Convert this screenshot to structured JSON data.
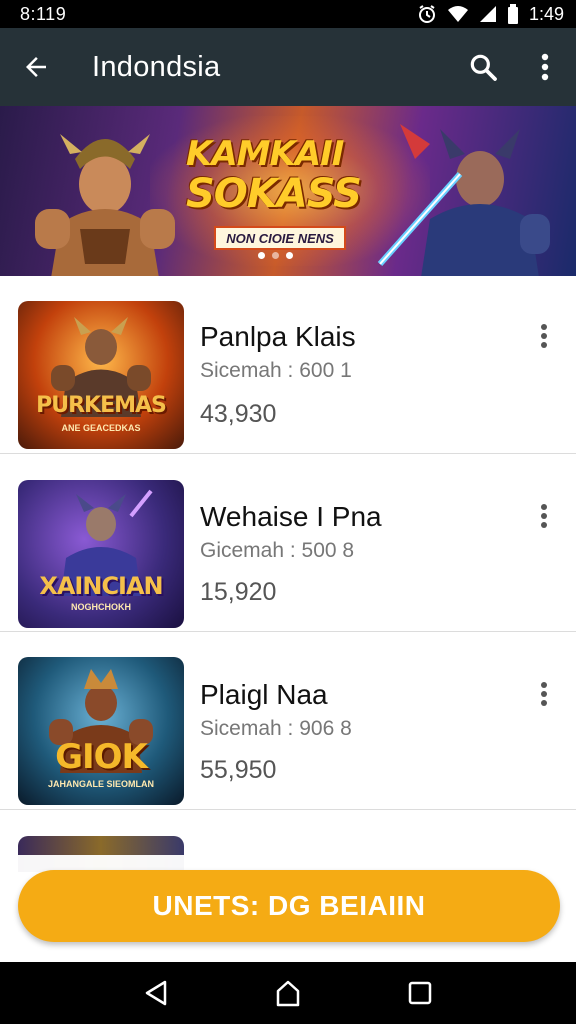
{
  "status_bar": {
    "time_left": "8:119",
    "time_right": "1:49"
  },
  "app_bar": {
    "title": "Indondsia"
  },
  "banner": {
    "title_line1": "KAMKAII",
    "title_line2": "SOKASS",
    "subtitle": "NON CIOIE NENS"
  },
  "items": [
    {
      "title": "Panlpa Klais",
      "meta": "Sicemah : 600 1",
      "count": "43,930",
      "thumb_logo": "PURKEMAS",
      "thumb_sub": "ANE GEACEDKAS",
      "logo_color": "#f5c04a",
      "accent": "#c2410c"
    },
    {
      "title": "Wehaise I Pna",
      "meta": "Gicemah : 500 8",
      "count": "15,920",
      "thumb_logo": "XAINCIAN",
      "thumb_sub": "NOGHCHOKH",
      "logo_color": "#f5c04a",
      "accent": "#5b2a9a"
    },
    {
      "title": "Plaigl Naa",
      "meta": "Sicemah : 906 8",
      "count": "55,950",
      "thumb_logo": "GIOK",
      "thumb_sub": "JAHANGALE SIEOMLAN",
      "logo_color": "#f5b82a",
      "accent": "#1f5a7a"
    }
  ],
  "cta": {
    "label": "UNETS: DG BEIAIIN"
  },
  "colors": {
    "app_bar": "#263238",
    "cta": "#f5ab14",
    "status_bar": "#000000"
  },
  "icons": [
    "back-arrow-icon",
    "search-icon",
    "more-vert-icon",
    "alarm-icon",
    "wifi-icon",
    "signal-icon",
    "battery-icon",
    "nav-back-icon",
    "nav-home-icon",
    "nav-recents-icon"
  ]
}
